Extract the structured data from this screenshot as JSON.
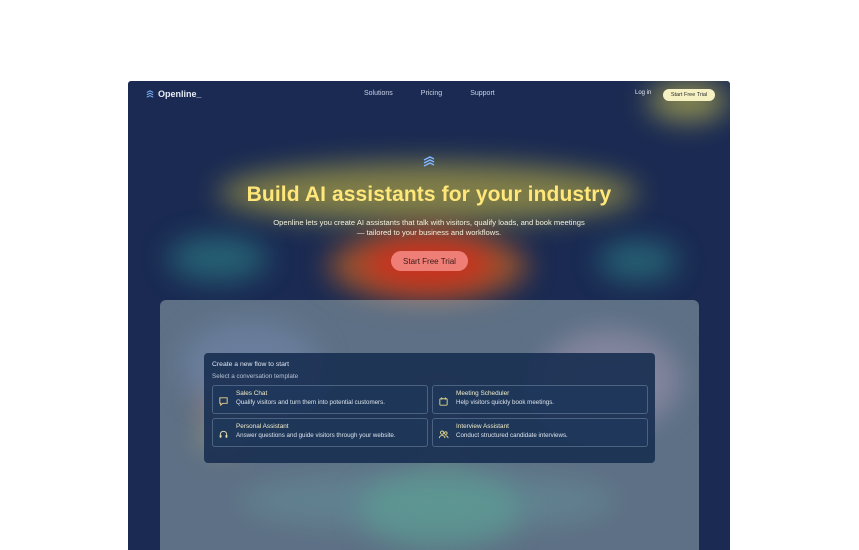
{
  "nav": {
    "brand": "Openline_",
    "links": [
      "Solutions",
      "Pricing",
      "Support"
    ],
    "login": "Log in",
    "cta": "Start Free Trial"
  },
  "hero": {
    "title": "Build AI assistants for your industry",
    "subtitle_line1": "Openline lets you create AI assistants that talk with visitors, qualify loads, and book meetings",
    "subtitle_line2": "— tailored to your business and workflows.",
    "cta": "Start Free Trial"
  },
  "panel": {
    "title": "Create a new flow to start",
    "subtitle": "Select a conversation template",
    "templates": [
      {
        "title": "Sales Chat",
        "desc": "Qualify visitors and turn them into potential customers.",
        "icon": "chat-icon"
      },
      {
        "title": "Meeting Scheduler",
        "desc": "Help visitors quickly book meetings.",
        "icon": "calendar-icon"
      },
      {
        "title": "Personal Assistant",
        "desc": "Answer questions and guide visitors through your website.",
        "icon": "headset-icon"
      },
      {
        "title": "Interview Assistant",
        "desc": "Conduct structured candidate interviews.",
        "icon": "users-icon"
      }
    ]
  },
  "colors": {
    "background": "#1a2a52",
    "title": "#ffe77a",
    "cta_top": "#f6f1c3",
    "cta_hero": "#ef7f76"
  }
}
